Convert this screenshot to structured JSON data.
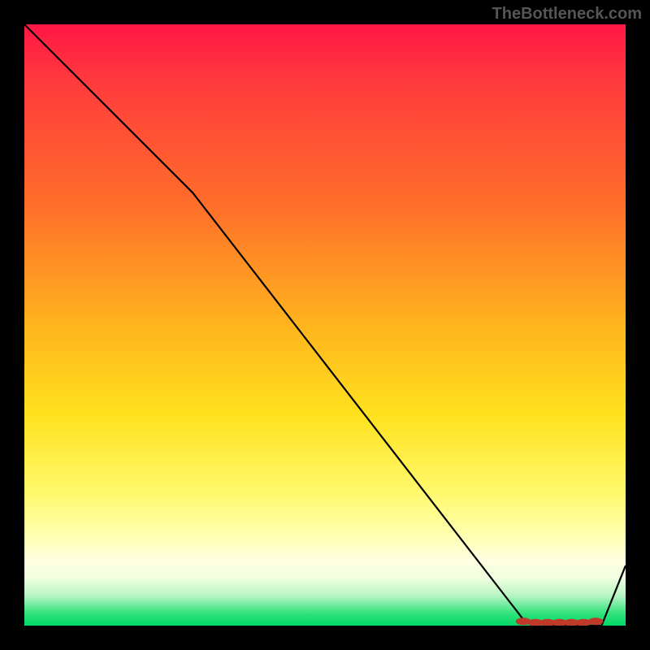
{
  "watermark": "TheBottleneck.com",
  "chart_data": {
    "type": "line",
    "title": "",
    "xlabel": "",
    "ylabel": "",
    "xlim": [
      0,
      100
    ],
    "ylim": [
      0,
      100
    ],
    "series": [
      {
        "name": "curve",
        "x": [
          0,
          28,
          83,
          88,
          96,
          100
        ],
        "y": [
          100,
          72,
          1,
          0,
          0,
          10
        ]
      }
    ],
    "markers": {
      "name": "highlight",
      "x": [
        83,
        85,
        87,
        89,
        91,
        93,
        95
      ],
      "y": [
        0.7,
        0.5,
        0.5,
        0.5,
        0.5,
        0.5,
        0.7
      ]
    },
    "background_gradient": {
      "top": "#ff1744",
      "mid": "#ffe21e",
      "bottom": "#00d968"
    }
  }
}
